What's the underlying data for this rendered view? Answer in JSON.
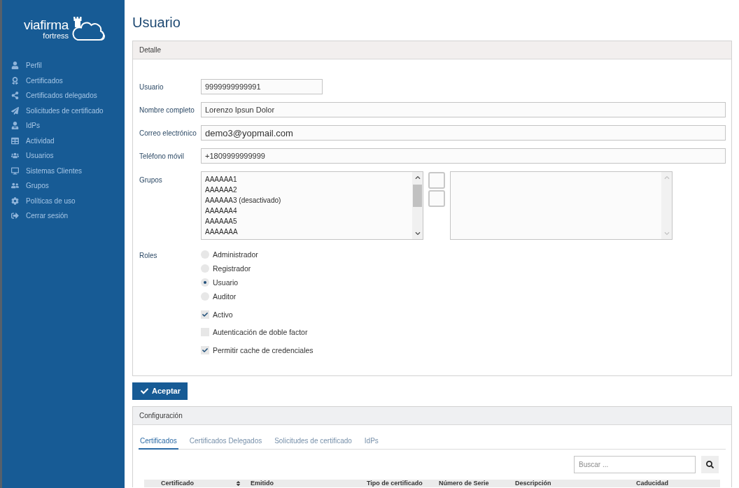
{
  "sidebar": {
    "logo": {
      "name": "viafirma",
      "subtitle": "fortress"
    },
    "items": [
      {
        "label": "Perfil"
      },
      {
        "label": "Certificados"
      },
      {
        "label": "Certificados delegados"
      },
      {
        "label": "Solicitudes de certificado"
      },
      {
        "label": "IdPs"
      },
      {
        "label": "Actividad"
      },
      {
        "label": "Usuarios"
      },
      {
        "label": "Sistemas Clientes"
      },
      {
        "label": "Grupos"
      },
      {
        "label": "Políticas de uso"
      },
      {
        "label": "Cerrar sesión"
      }
    ]
  },
  "page": {
    "title": "Usuario"
  },
  "detail_panel": {
    "title": "Detalle",
    "fields": [
      {
        "kind": "username",
        "label": "Usuario",
        "value": "9999999999991"
      },
      {
        "kind": "text",
        "label": "Nombre completo",
        "value": "Lorenzo Ipsun Dolor"
      },
      {
        "kind": "email",
        "label": "Correo electrónico",
        "value": "demo3@yopmail.com"
      },
      {
        "kind": "text",
        "label": "Teléfono móvil",
        "value": "+1809999999999"
      }
    ],
    "groups": {
      "label": "Grupos",
      "available": [
        "AAAAAA1",
        "AAAAAA2",
        "AAAAAA3 (desactivado)",
        "AAAAAA4",
        "AAAAAA5",
        "AAAAAAA"
      ]
    },
    "roles": {
      "label": "Roles",
      "options": [
        {
          "label": "Administrador",
          "selected": false
        },
        {
          "label": "Registrador",
          "selected": false
        },
        {
          "label": "Usuario",
          "selected": true
        },
        {
          "label": "Auditor",
          "selected": false
        }
      ]
    },
    "checkboxes": [
      {
        "label": "Activo",
        "checked": true
      },
      {
        "label": "Autenticación de doble factor",
        "checked": false
      },
      {
        "label": "Permitir cache de credenciales",
        "checked": true
      }
    ]
  },
  "accept_button": {
    "label": "Aceptar"
  },
  "config_panel": {
    "title": "Configuración",
    "tabs": [
      {
        "label": "Certificados",
        "selected": true
      },
      {
        "label": "Certificados Delegados",
        "selected": false
      },
      {
        "label": "Solicitudes de certificado",
        "selected": false
      },
      {
        "label": "IdPs",
        "selected": false
      }
    ],
    "search": {
      "placeholder": "Buscar ..."
    },
    "table": {
      "columns": [
        {
          "label": "Certificado",
          "sortable": true
        },
        {
          "label": "Emitido",
          "sortable": false
        },
        {
          "label": "Tipo de certificado",
          "sortable": false
        },
        {
          "label": "Número de Serie",
          "sortable": false
        },
        {
          "label": "Descripción",
          "sortable": false
        },
        {
          "label": "Caducidad",
          "sortable": false
        }
      ]
    }
  }
}
